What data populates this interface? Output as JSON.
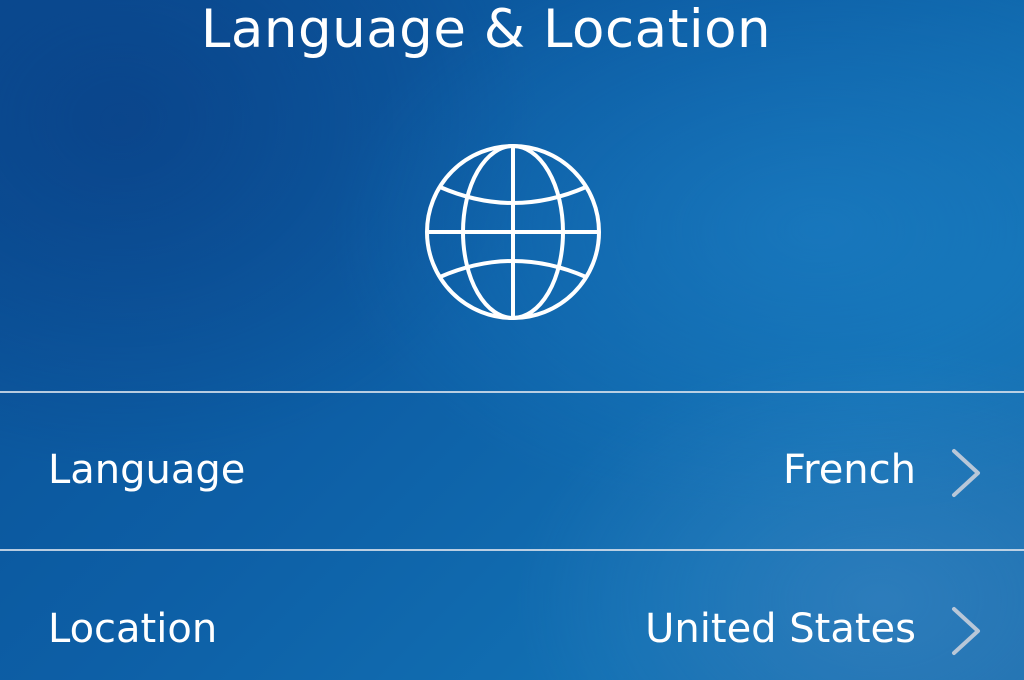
{
  "header": {
    "title": "Language & Location"
  },
  "icons": {
    "hero": "globe-icon",
    "disclosure": "chevron-right-icon"
  },
  "settings": [
    {
      "label": "Language",
      "value": "French"
    },
    {
      "label": "Location",
      "value": "United States"
    }
  ],
  "colors": {
    "background": "#0d5fa6",
    "text": "#ffffff",
    "divider": "#d7e1ec",
    "chevron": "#b8c7d8"
  }
}
